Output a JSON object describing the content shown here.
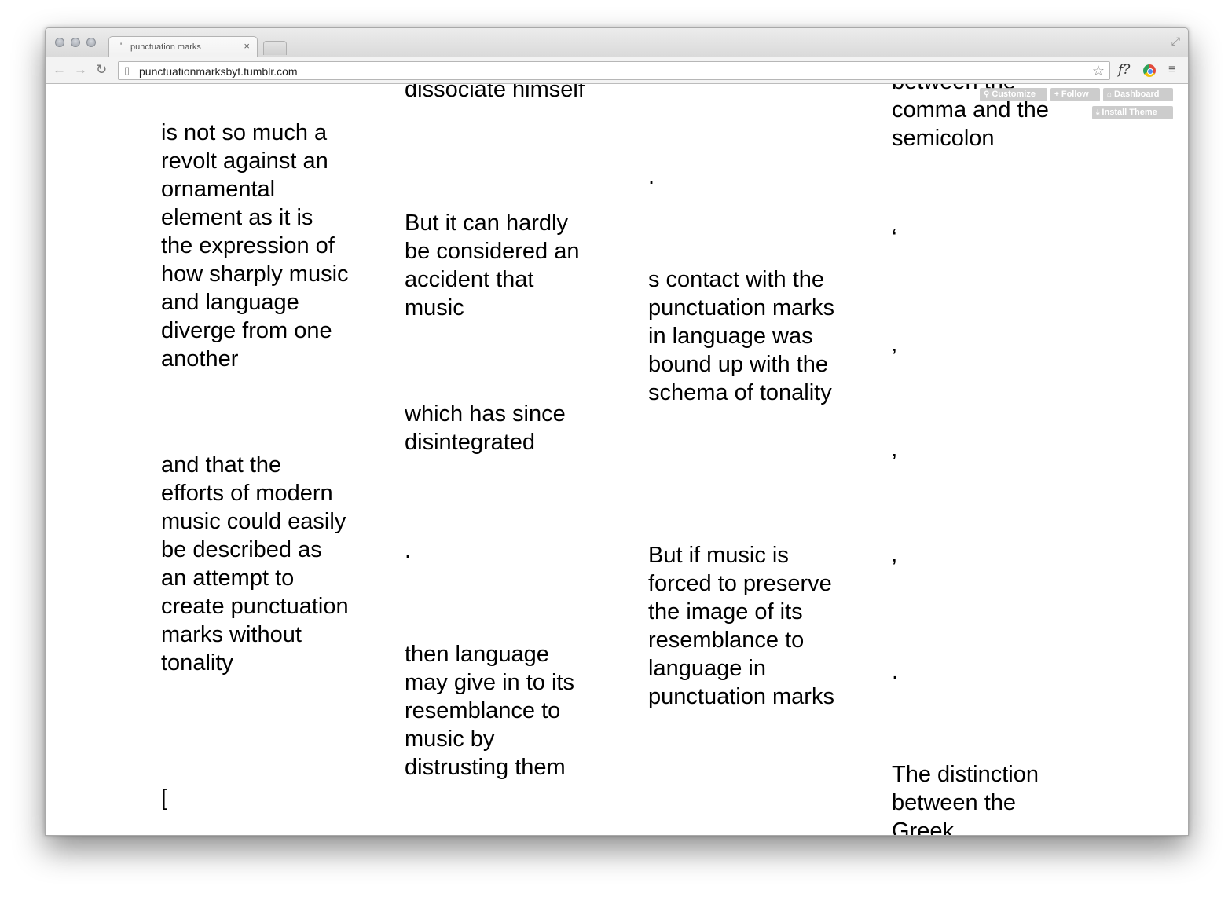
{
  "browser": {
    "tab_favicon": "'",
    "tab_title": "punctuation marks",
    "tab_close": "×",
    "url": "punctuationmarksbyt.tumblr.com",
    "ext_label": "f?"
  },
  "tumblr_controls": {
    "customize": "Customize",
    "follow": "Follow",
    "dashboard": "Dashboard",
    "install_theme": "Install Theme"
  },
  "columns": [
    {
      "posts": [
        "is not so much a revolt against an ornamental element as it is the expression of how sharply music and language diverge from one another",
        "and that the efforts of modern music could easily be described as an attempt to create punctuation marks without tonality",
        "["
      ]
    },
    {
      "posts": [
        "dissociate himself",
        "But it can hardly be considered an accident that music",
        "which has since disintegrated",
        ".",
        "then language may give in to its resemblance to music by distrusting them"
      ]
    },
    {
      "posts": [
        ".",
        "s contact with the punctuation marks in language was bound up with the schema of tonality",
        "But if music is forced to preserve the image of its resemblance to language in punctuation marks"
      ]
    },
    {
      "posts": [
        "between the comma and the semicolon",
        "‘",
        "’",
        "’",
        "’",
        ".",
        "The distinction between the Greek"
      ]
    }
  ]
}
